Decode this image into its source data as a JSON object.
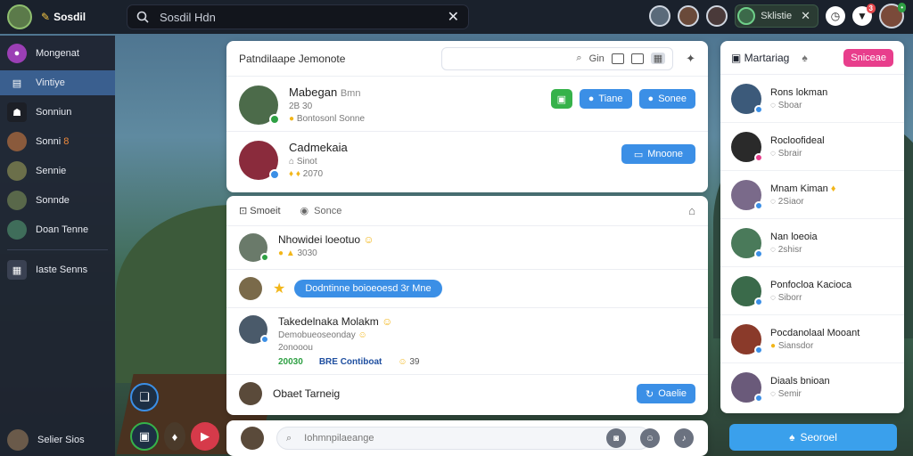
{
  "app": {
    "brand": "Sosdil",
    "brand_icon": "✎"
  },
  "topbar": {
    "search_label": "Sosdil Hdn",
    "chip_label": "Sklistie",
    "notif_count": "3"
  },
  "sidebar": {
    "items": [
      {
        "label": "Mongenat",
        "icon": "●",
        "color": "#9b3fb5"
      },
      {
        "label": "Vintiye",
        "icon": "▤",
        "color": "#2f6fb0"
      },
      {
        "label": "Sonniun",
        "icon": "☷",
        "color": "#1c1f26"
      },
      {
        "label": "Sonni",
        "tag": "8",
        "icon": "",
        "color": "#8a5a3c"
      },
      {
        "label": "Sennie",
        "icon": "",
        "color": "#6b6f4a"
      },
      {
        "label": "Sonnde",
        "icon": "",
        "color": "#59684a"
      },
      {
        "label": "Doan Tenne",
        "icon": "",
        "color": "#3f6d5a"
      }
    ],
    "extra": "Iaste Senns",
    "footer": "Selier Sios"
  },
  "main": {
    "title": "Patndilaape Jemonote",
    "search_a": "Gin",
    "people": [
      {
        "name": "Mabegan",
        "name2": "Bmn",
        "sub1": "2B 30",
        "sub2": "Bontosonl Sonne",
        "status": "#2ea043",
        "color": "#4c6b4a",
        "actions": [
          "Tiane",
          "Sonee"
        ]
      },
      {
        "name": "Cadmekaia",
        "name2": "",
        "sub1": "Sinot",
        "sub2": "2070",
        "status": "#3b8fe6",
        "color": "#8a2b3c",
        "actions": [
          "Mnoone"
        ]
      }
    ]
  },
  "feed": {
    "tab1": "Smoeit",
    "tab2": "Sonce",
    "items": [
      {
        "name": "Nhowidei loeotuo",
        "sub": "3030",
        "color": "#6a7a6a",
        "status": "#2ea043"
      },
      {
        "bubble": "Dodntinne boioeoesd 3r Mne",
        "color": "#7a6a4a"
      },
      {
        "name": "Takedelnaka Molakm",
        "sub1": "Demobueoseonday",
        "sub2": "2onooou",
        "stat_g": "20030",
        "stat_b": "BRE Contiboat",
        "stat_c": "39",
        "color": "#4a5a6a",
        "status": "#3b8fe6"
      },
      {
        "name": "Obaet Tarneig",
        "action": "Oaelie",
        "color": "#5a4a3a"
      }
    ]
  },
  "compose": {
    "placeholder": "Iohmnpilaeange"
  },
  "right": {
    "title": "Martariag",
    "pink_btn": "Sniceae",
    "contacts": [
      {
        "name": "Rons lokman",
        "sub": "Sboar",
        "color": "#3c5a7a",
        "status": "#3b8fe6"
      },
      {
        "name": "Rocloofideal",
        "sub": "Sbrair",
        "color": "#2a2a2a",
        "status": "#e83e8c"
      },
      {
        "name": "Mnam Kiman",
        "sub": "2Siaor",
        "color": "#7a6a8a",
        "status": "#3b8fe6"
      },
      {
        "name": "Nan loeoia",
        "sub": "2shisr",
        "color": "#4a7a5a",
        "status": "#3b8fe6"
      },
      {
        "name": "Ponfocloa Kacioca",
        "sub": "Siborr",
        "color": "#3a6a4a",
        "status": "#3b8fe6"
      },
      {
        "name": "Pocdanolaal Mooant",
        "sub": "Siansdor",
        "color": "#8a3a2a",
        "status": "#3b8fe6"
      },
      {
        "name": "Diaals bnioan",
        "sub": "Semir",
        "color": "#6a5a7a",
        "status": "#3b8fe6"
      }
    ],
    "join_label": "Seoroel"
  }
}
